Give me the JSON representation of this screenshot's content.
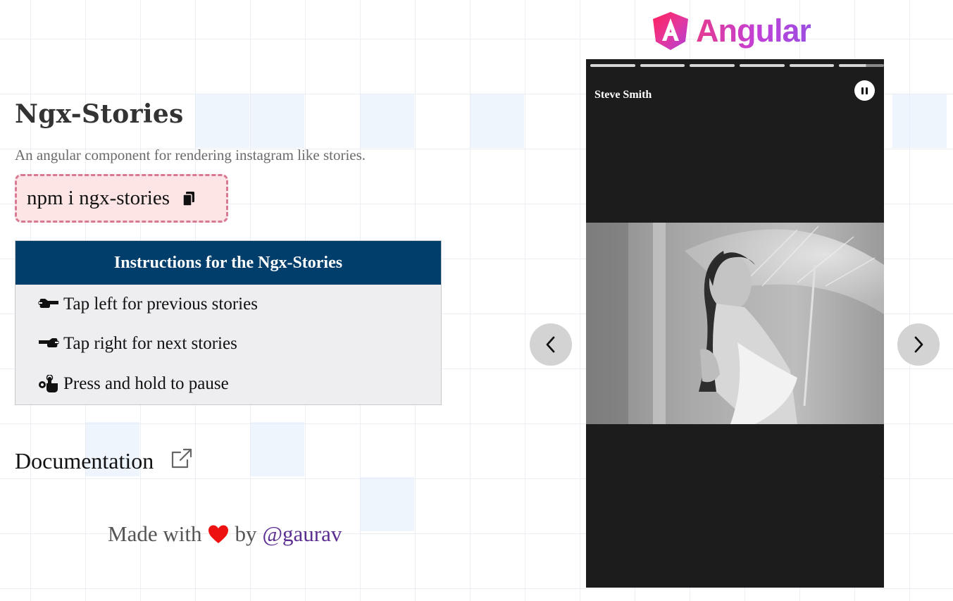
{
  "header": {
    "title": "Ngx-Stories",
    "subtitle": "An angular component for rendering instagram like stories."
  },
  "install": {
    "command": "npm i ngx-stories",
    "copy_icon": "copy-icon"
  },
  "instructions": {
    "title": "Instructions for the Ngx-Stories",
    "items": [
      {
        "icon": "pointing-left-hand-icon",
        "text": "Tap left for previous stories"
      },
      {
        "icon": "pointing-right-hand-icon",
        "text": "Tap right for next stories"
      },
      {
        "icon": "press-hold-icon",
        "text": "Press and hold to pause"
      }
    ]
  },
  "documentation": {
    "label": "Documentation",
    "icon": "external-link-icon"
  },
  "footer": {
    "made_with": "Made with",
    "by": "by",
    "author": "@gaurav",
    "heart_color": "#ee1111"
  },
  "brand": {
    "logo_text": "Angular"
  },
  "story": {
    "user_name": "Steve Smith",
    "segments_total": 6,
    "current_segment": 6,
    "current_segment_progress": 0.6,
    "is_paused": false
  },
  "colors": {
    "instructions_header": "#023e6b",
    "npm_box_border": "#d87a94",
    "npm_box_bg": "#fde5e5",
    "author_link": "#5a2d91",
    "story_bg": "#1c1c1c"
  }
}
